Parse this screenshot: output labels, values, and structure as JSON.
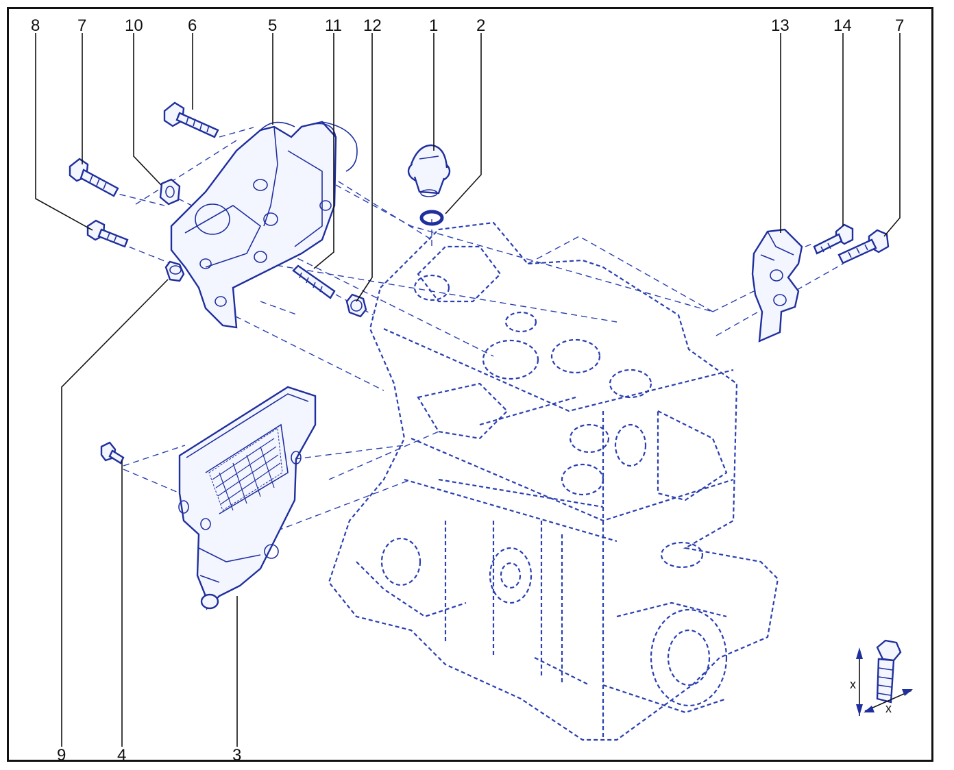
{
  "callouts": {
    "c1": "1",
    "c2": "2",
    "c3": "3",
    "c4": "4",
    "c5": "5",
    "c6": "6",
    "c7a": "7",
    "c7b": "7",
    "c8": "8",
    "c9": "9",
    "c10": "10",
    "c11": "11",
    "c12": "12",
    "c13": "13",
    "c14": "14"
  },
  "dimension_symbol": {
    "x1": "x",
    "x2": "x"
  },
  "colors": {
    "line": "#1f2f9e",
    "dash": "#2a3fb0",
    "text": "#111111"
  }
}
